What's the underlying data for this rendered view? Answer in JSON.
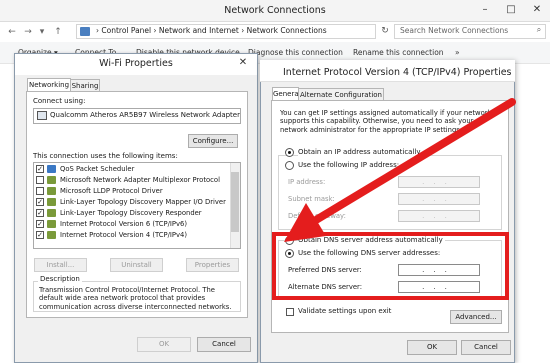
{
  "network_connections": {
    "title": "Network Connections",
    "window_buttons": {
      "minimize": "–",
      "maximize": "□",
      "close": "✕"
    },
    "nav": {
      "back": "←",
      "forward": "→",
      "dropdown": "▾",
      "up": "↑"
    },
    "address": "›  Control Panel  ›  Network and Internet  ›  Network Connections",
    "search_placeholder": "Search Network Connections",
    "toolbar": [
      "Organize ▾",
      "Connect To",
      "Disable this network device",
      "Diagnose this connection",
      "Rename this connection",
      "»"
    ]
  },
  "wifi_properties": {
    "title": "Wi-Fi Properties",
    "close": "✕",
    "tabs": [
      "Networking",
      "Sharing"
    ],
    "connect_using_label": "Connect using:",
    "adapter": "Qualcomm Atheros AR5B97 Wireless Network Adapter",
    "configure_button": "Configure...",
    "items_label": "This connection uses the following items:",
    "items": [
      {
        "checked": true,
        "label": "QoS Packet Scheduler",
        "color": "#3b78c4"
      },
      {
        "checked": false,
        "label": "Microsoft Network Adapter Multiplexor Protocol",
        "color": "#7a9a3a"
      },
      {
        "checked": false,
        "label": "Microsoft LLDP Protocol Driver",
        "color": "#7a9a3a"
      },
      {
        "checked": true,
        "label": "Link-Layer Topology Discovery Mapper I/O Driver",
        "color": "#7a9a3a"
      },
      {
        "checked": true,
        "label": "Link-Layer Topology Discovery Responder",
        "color": "#7a9a3a"
      },
      {
        "checked": true,
        "label": "Internet Protocol Version 6 (TCP/IPv6)",
        "color": "#7a9a3a"
      },
      {
        "checked": true,
        "label": "Internet Protocol Version 4 (TCP/IPv4)",
        "color": "#7a9a3a"
      }
    ],
    "buttons": {
      "install": "Install...",
      "uninstall": "Uninstall",
      "properties": "Properties"
    },
    "description_label": "Description",
    "description": "Transmission Control Protocol/Internet Protocol. The default wide area network protocol that provides communication across diverse interconnected networks.",
    "ok": "OK",
    "cancel": "Cancel"
  },
  "ipv4_properties": {
    "title": "Internet Protocol Version 4 (TCP/IPv4) Properties",
    "tabs": [
      "General",
      "Alternate Configuration"
    ],
    "intro": "You can get IP settings assigned automatically if your network supports this capability. Otherwise, you need to ask your network administrator for the appropriate IP settings.",
    "obtain_ip": "Obtain an IP address automatically",
    "use_ip": "Use the following IP address:",
    "ip_address_label": "IP address:",
    "subnet_label": "Subnet mask:",
    "gateway_label": "Default gateway:",
    "obtain_dns": "Obtain DNS server address automatically",
    "use_dns": "Use the following DNS server addresses:",
    "preferred_dns_label": "Preferred DNS server:",
    "alternate_dns_label": "Alternate DNS server:",
    "ip_placeholder": "...",
    "validate": "Validate settings upon exit",
    "advanced": "Advanced...",
    "ok": "OK",
    "cancel": "Cancel",
    "selected_ip_mode": "obtain",
    "selected_dns_mode": "use"
  },
  "annotation": {
    "color": "#e41d1d"
  }
}
